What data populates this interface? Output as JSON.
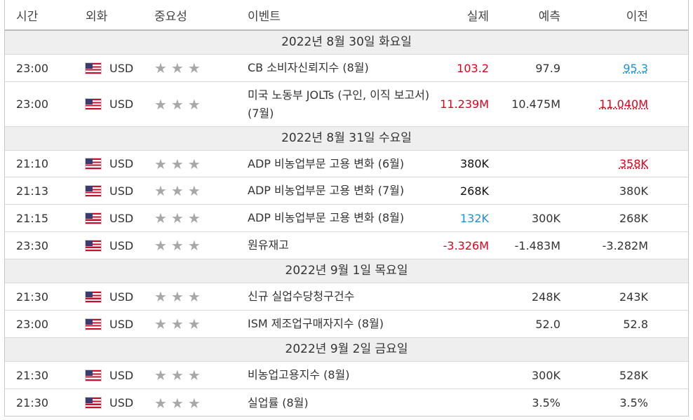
{
  "header": {
    "time": "시간",
    "currency": "외화",
    "importance": "중요성",
    "event": "이벤트",
    "actual": "실제",
    "forecast": "예측",
    "previous": "이전"
  },
  "dates": [
    "2022년 8월 30일 화요일",
    "2022년 8월 31일 수요일",
    "2022년 9월 1일 목요일",
    "2022년 9월 2일 금요일"
  ],
  "rows": [
    {
      "time": "23:00",
      "currency": "USD",
      "importance": "★★★",
      "event": "CB 소비자신뢰지수 (8월)",
      "actual": "103.2",
      "forecast": "97.9",
      "previous": "95.3"
    },
    {
      "time": "23:00",
      "currency": "USD",
      "importance": "★★★",
      "event": "미국 노동부 JOLTs (구인, 이직 보고서) (7월)",
      "actual": "11.239M",
      "forecast": "10.475M",
      "previous": "11.040M"
    },
    {
      "time": "21:10",
      "currency": "USD",
      "importance": "★★★",
      "event": "ADP 비농업부문 고용 변화 (6월)",
      "actual": "380K",
      "forecast": "",
      "previous": "358K"
    },
    {
      "time": "21:13",
      "currency": "USD",
      "importance": "★★★",
      "event": "ADP 비농업부문 고용 변화 (7월)",
      "actual": "268K",
      "forecast": "",
      "previous": "380K"
    },
    {
      "time": "21:15",
      "currency": "USD",
      "importance": "★★★",
      "event": "ADP 비농업부문 고용 변화 (8월)",
      "actual": "132K",
      "forecast": "300K",
      "previous": "268K"
    },
    {
      "time": "23:30",
      "currency": "USD",
      "importance": "★★★",
      "event": "원유재고",
      "actual": "-3.326M",
      "forecast": "-1.483M",
      "previous": "-3.282M"
    },
    {
      "time": "21:30",
      "currency": "USD",
      "importance": "★★★",
      "event": "신규 실업수당청구건수",
      "actual": "",
      "forecast": "248K",
      "previous": "243K"
    },
    {
      "time": "23:00",
      "currency": "USD",
      "importance": "★★★",
      "event": "ISM 제조업구매자지수 (8월)",
      "actual": "",
      "forecast": "52.0",
      "previous": "52.8"
    },
    {
      "time": "21:30",
      "currency": "USD",
      "importance": "★★★",
      "event": "비농업고용지수 (8월)",
      "actual": "",
      "forecast": "300K",
      "previous": "528K"
    },
    {
      "time": "21:30",
      "currency": "USD",
      "importance": "★★★",
      "event": "실업률 (8월)",
      "actual": "",
      "forecast": "3.5%",
      "previous": "3.5%"
    }
  ],
  "colors": {
    "negative": "#e0001a",
    "positive": "#1e90d6",
    "date_bar_bg": "#efefef",
    "star": "#a8a8a8"
  },
  "icons": {
    "flag": "us-flag-icon",
    "importance": "star-icon"
  }
}
